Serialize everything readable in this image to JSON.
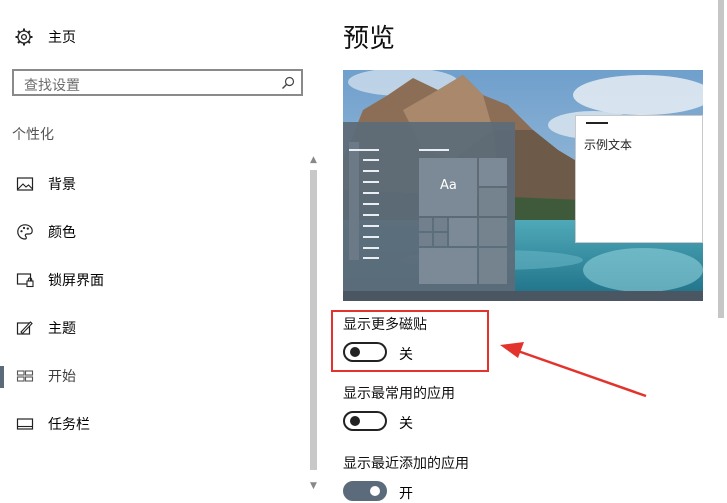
{
  "sidebar": {
    "home_label": "主页",
    "search_placeholder": "查找设置",
    "section_title": "个性化",
    "items": [
      {
        "label": "背景",
        "icon": "image-icon"
      },
      {
        "label": "颜色",
        "icon": "palette-icon"
      },
      {
        "label": "锁屏界面",
        "icon": "lock-screen-icon"
      },
      {
        "label": "主题",
        "icon": "theme-icon"
      },
      {
        "label": "开始",
        "icon": "start-icon",
        "active": true
      },
      {
        "label": "任务栏",
        "icon": "taskbar-icon"
      }
    ]
  },
  "main": {
    "title": "预览",
    "preview": {
      "tile_text": "Aa",
      "sample_text": "示例文本"
    },
    "options": [
      {
        "label": "显示更多磁贴",
        "state": "关",
        "on": false
      },
      {
        "label": "显示最常用的应用",
        "state": "关",
        "on": false
      },
      {
        "label": "显示最近添加的应用",
        "state": "开",
        "on": true
      }
    ]
  },
  "annotation": {
    "color": "#e3332d"
  },
  "colors": {
    "accent": "#5b6b7b",
    "highlight": "#e3332d"
  }
}
